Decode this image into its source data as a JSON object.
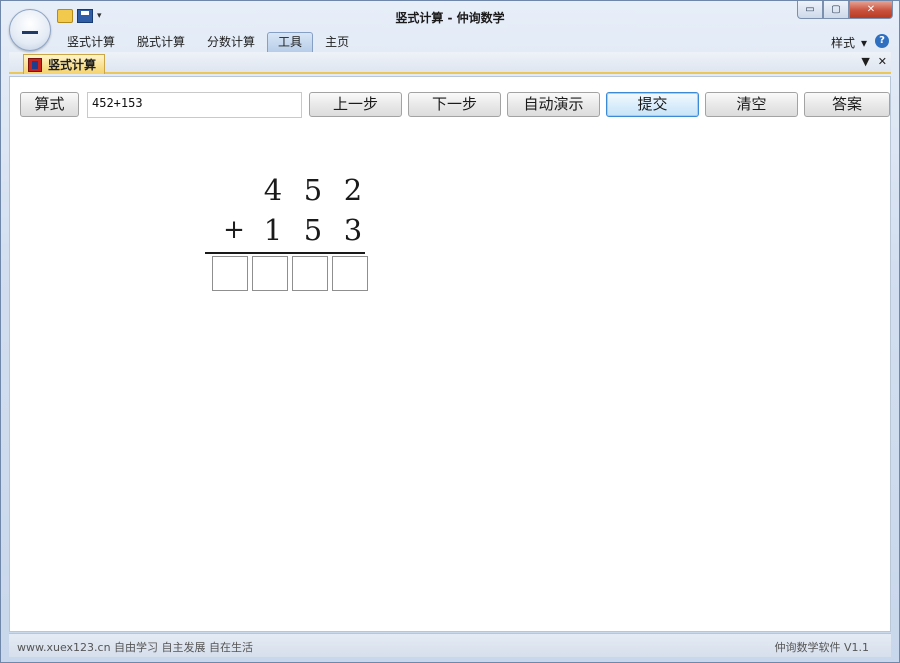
{
  "window": {
    "title": "竖式计算 - 仲询数学",
    "controls": {
      "minimize": "▭",
      "maximize": "▢",
      "close": "✕"
    }
  },
  "ribbon": {
    "tabs": [
      {
        "label": "竖式计算"
      },
      {
        "label": "脱式计算"
      },
      {
        "label": "分数计算"
      },
      {
        "label": "工具",
        "active": true
      },
      {
        "label": "主页"
      }
    ],
    "style_menu": "样式",
    "help": "?"
  },
  "doc_tab": {
    "label": "竖式计算"
  },
  "toolbar": {
    "formula_button": "算式",
    "expression_value": "452+153",
    "prev_step": "上一步",
    "next_step": "下一步",
    "auto_demo": "自动演示",
    "submit": "提交",
    "clear": "清空",
    "answer": "答案"
  },
  "calculation": {
    "row1": [
      "4",
      "5",
      "2"
    ],
    "operator": "+",
    "row2": [
      "1",
      "5",
      "3"
    ],
    "answer_boxes": 4
  },
  "status": {
    "left": "www.xuex123.cn 自由学习 自主发展 自在生活",
    "right": "仲询数学软件 V1.1"
  },
  "colors": {
    "accent_tab": "#f4d36b",
    "focus_border": "#3c8ad6",
    "close_button": "#c9533d"
  }
}
